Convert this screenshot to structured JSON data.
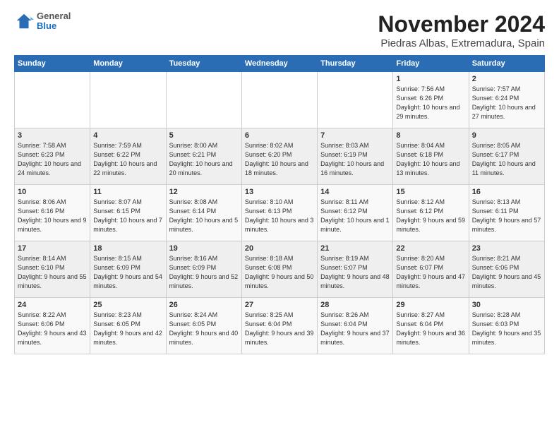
{
  "logo": {
    "general": "General",
    "blue": "Blue"
  },
  "header": {
    "month": "November 2024",
    "location": "Piedras Albas, Extremadura, Spain"
  },
  "weekdays": [
    "Sunday",
    "Monday",
    "Tuesday",
    "Wednesday",
    "Thursday",
    "Friday",
    "Saturday"
  ],
  "weeks": [
    [
      {
        "day": "",
        "detail": ""
      },
      {
        "day": "",
        "detail": ""
      },
      {
        "day": "",
        "detail": ""
      },
      {
        "day": "",
        "detail": ""
      },
      {
        "day": "",
        "detail": ""
      },
      {
        "day": "1",
        "detail": "Sunrise: 7:56 AM\nSunset: 6:26 PM\nDaylight: 10 hours\nand 29 minutes."
      },
      {
        "day": "2",
        "detail": "Sunrise: 7:57 AM\nSunset: 6:24 PM\nDaylight: 10 hours\nand 27 minutes."
      }
    ],
    [
      {
        "day": "3",
        "detail": "Sunrise: 7:58 AM\nSunset: 6:23 PM\nDaylight: 10 hours\nand 24 minutes."
      },
      {
        "day": "4",
        "detail": "Sunrise: 7:59 AM\nSunset: 6:22 PM\nDaylight: 10 hours\nand 22 minutes."
      },
      {
        "day": "5",
        "detail": "Sunrise: 8:00 AM\nSunset: 6:21 PM\nDaylight: 10 hours\nand 20 minutes."
      },
      {
        "day": "6",
        "detail": "Sunrise: 8:02 AM\nSunset: 6:20 PM\nDaylight: 10 hours\nand 18 minutes."
      },
      {
        "day": "7",
        "detail": "Sunrise: 8:03 AM\nSunset: 6:19 PM\nDaylight: 10 hours\nand 16 minutes."
      },
      {
        "day": "8",
        "detail": "Sunrise: 8:04 AM\nSunset: 6:18 PM\nDaylight: 10 hours\nand 13 minutes."
      },
      {
        "day": "9",
        "detail": "Sunrise: 8:05 AM\nSunset: 6:17 PM\nDaylight: 10 hours\nand 11 minutes."
      }
    ],
    [
      {
        "day": "10",
        "detail": "Sunrise: 8:06 AM\nSunset: 6:16 PM\nDaylight: 10 hours\nand 9 minutes."
      },
      {
        "day": "11",
        "detail": "Sunrise: 8:07 AM\nSunset: 6:15 PM\nDaylight: 10 hours\nand 7 minutes."
      },
      {
        "day": "12",
        "detail": "Sunrise: 8:08 AM\nSunset: 6:14 PM\nDaylight: 10 hours\nand 5 minutes."
      },
      {
        "day": "13",
        "detail": "Sunrise: 8:10 AM\nSunset: 6:13 PM\nDaylight: 10 hours\nand 3 minutes."
      },
      {
        "day": "14",
        "detail": "Sunrise: 8:11 AM\nSunset: 6:12 PM\nDaylight: 10 hours\nand 1 minute."
      },
      {
        "day": "15",
        "detail": "Sunrise: 8:12 AM\nSunset: 6:12 PM\nDaylight: 9 hours\nand 59 minutes."
      },
      {
        "day": "16",
        "detail": "Sunrise: 8:13 AM\nSunset: 6:11 PM\nDaylight: 9 hours\nand 57 minutes."
      }
    ],
    [
      {
        "day": "17",
        "detail": "Sunrise: 8:14 AM\nSunset: 6:10 PM\nDaylight: 9 hours\nand 55 minutes."
      },
      {
        "day": "18",
        "detail": "Sunrise: 8:15 AM\nSunset: 6:09 PM\nDaylight: 9 hours\nand 54 minutes."
      },
      {
        "day": "19",
        "detail": "Sunrise: 8:16 AM\nSunset: 6:09 PM\nDaylight: 9 hours\nand 52 minutes."
      },
      {
        "day": "20",
        "detail": "Sunrise: 8:18 AM\nSunset: 6:08 PM\nDaylight: 9 hours\nand 50 minutes."
      },
      {
        "day": "21",
        "detail": "Sunrise: 8:19 AM\nSunset: 6:07 PM\nDaylight: 9 hours\nand 48 minutes."
      },
      {
        "day": "22",
        "detail": "Sunrise: 8:20 AM\nSunset: 6:07 PM\nDaylight: 9 hours\nand 47 minutes."
      },
      {
        "day": "23",
        "detail": "Sunrise: 8:21 AM\nSunset: 6:06 PM\nDaylight: 9 hours\nand 45 minutes."
      }
    ],
    [
      {
        "day": "24",
        "detail": "Sunrise: 8:22 AM\nSunset: 6:06 PM\nDaylight: 9 hours\nand 43 minutes."
      },
      {
        "day": "25",
        "detail": "Sunrise: 8:23 AM\nSunset: 6:05 PM\nDaylight: 9 hours\nand 42 minutes."
      },
      {
        "day": "26",
        "detail": "Sunrise: 8:24 AM\nSunset: 6:05 PM\nDaylight: 9 hours\nand 40 minutes."
      },
      {
        "day": "27",
        "detail": "Sunrise: 8:25 AM\nSunset: 6:04 PM\nDaylight: 9 hours\nand 39 minutes."
      },
      {
        "day": "28",
        "detail": "Sunrise: 8:26 AM\nSunset: 6:04 PM\nDaylight: 9 hours\nand 37 minutes."
      },
      {
        "day": "29",
        "detail": "Sunrise: 8:27 AM\nSunset: 6:04 PM\nDaylight: 9 hours\nand 36 minutes."
      },
      {
        "day": "30",
        "detail": "Sunrise: 8:28 AM\nSunset: 6:03 PM\nDaylight: 9 hours\nand 35 minutes."
      }
    ]
  ]
}
